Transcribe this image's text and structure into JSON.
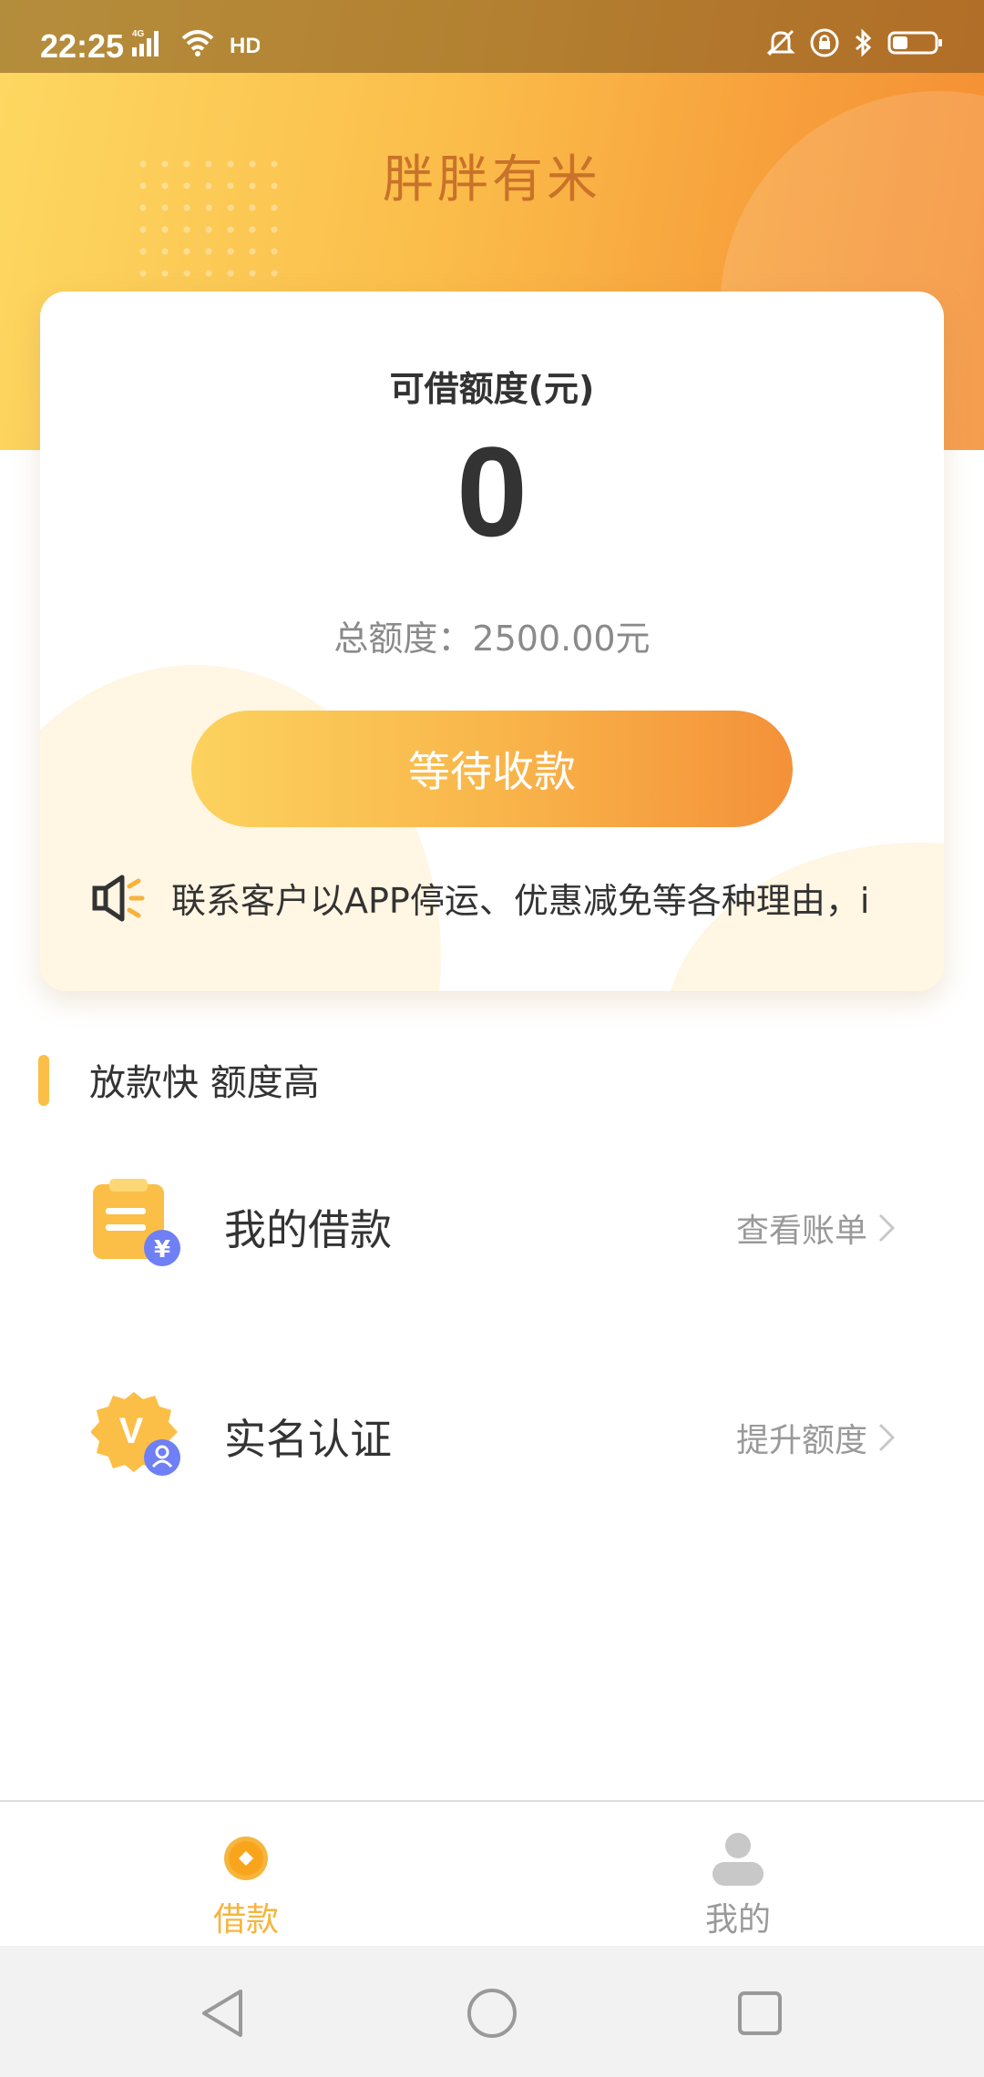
{
  "status_bar": {
    "time": "22:25",
    "left_icons": [
      "signal-4g-icon",
      "wifi-icon",
      "hd-icon"
    ],
    "right_icons": [
      "bell-off-icon",
      "lock-rotation-icon",
      "bluetooth-icon",
      "battery-icon"
    ]
  },
  "header": {
    "title": "胖胖有米"
  },
  "card": {
    "label": "可借额度(元)",
    "amount": "0",
    "total": "总额度：2500.00元",
    "button": "等待收款",
    "notice": "联系客户以APP停运、优惠减免等各种理由，i",
    "notice_icon": "speaker-icon"
  },
  "section": {
    "title": "放款快 额度高"
  },
  "menu": [
    {
      "label": "我的借款",
      "action": "查看账单",
      "icon": "loan-bill-icon"
    },
    {
      "label": "实名认证",
      "action": "提升额度",
      "icon": "verified-badge-icon"
    }
  ],
  "tabs": [
    {
      "label": "借款",
      "icon": "coin-icon",
      "active": true
    },
    {
      "label": "我的",
      "icon": "user-icon",
      "active": false
    }
  ],
  "colors": {
    "accent": "#fbbf47",
    "tab_active": "#f6b53e",
    "tab_inactive": "#9a9a9a",
    "title": "#c9722a"
  }
}
